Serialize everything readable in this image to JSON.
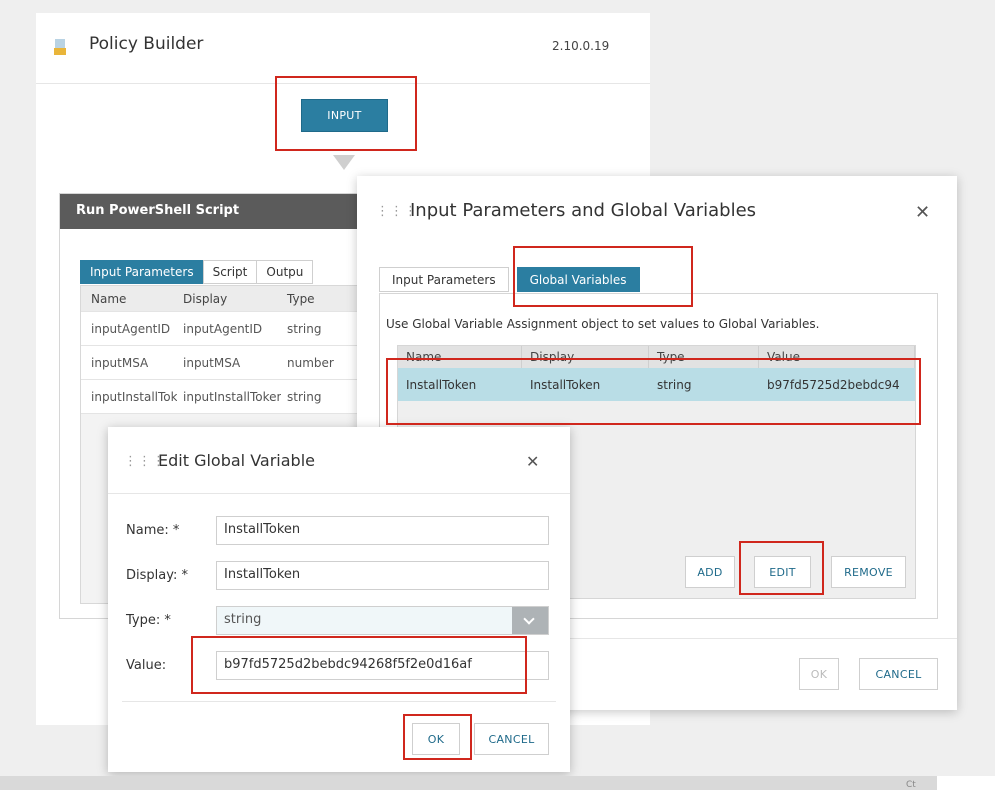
{
  "builder": {
    "title": "Policy Builder",
    "version": "2.10.0.19",
    "logo_icon": "document-icon",
    "input_node_label": "INPUT"
  },
  "script_panel": {
    "title": "Run PowerShell Script",
    "tabs": [
      "Input Parameters",
      "Script",
      "Outpu"
    ],
    "columns": [
      "Name",
      "Display",
      "Type"
    ],
    "rows": [
      [
        "inputAgentID",
        "inputAgentID",
        "string"
      ],
      [
        "inputMSA",
        "inputMSA",
        "number"
      ],
      [
        "inputInstallToken",
        "inputInstallToken",
        "string"
      ]
    ]
  },
  "params_dialog": {
    "grip_icon": "drag-grip-icon",
    "title": "Input Parameters and Global Variables",
    "close_icon": "close-icon",
    "tabs": [
      "Input Parameters",
      "Global Variables"
    ],
    "description": "Use Global Variable Assignment object to set values to Global Variables.",
    "columns": [
      "Name",
      "Display",
      "Type",
      "Value"
    ],
    "rows": [
      [
        "InstallToken",
        "InstallToken",
        "string",
        "b97fd5725d2bebdc94"
      ]
    ],
    "buttons": {
      "add": "ADD",
      "edit": "EDIT",
      "remove": "REMOVE",
      "ok": "OK",
      "cancel": "CANCEL"
    }
  },
  "edit_dialog": {
    "grip_icon": "drag-grip-icon",
    "title": "Edit Global Variable",
    "close_icon": "close-icon",
    "fields": {
      "name_label": "Name: *",
      "name_value": "InstallToken",
      "display_label": "Display: *",
      "display_value": "InstallToken",
      "type_label": "Type: *",
      "type_value": "string",
      "value_label": "Value:",
      "value_value": "b97fd5725d2bebdc94268f5f2e0d16af"
    },
    "buttons": {
      "ok": "OK",
      "cancel": "CANCEL"
    }
  },
  "taskbar": {
    "text": "Ct"
  },
  "colors": {
    "accent": "#2b7ea1",
    "highlight": "#d0271d",
    "selected_row": "#b9dde6",
    "panel_header": "#5b5b5b"
  }
}
